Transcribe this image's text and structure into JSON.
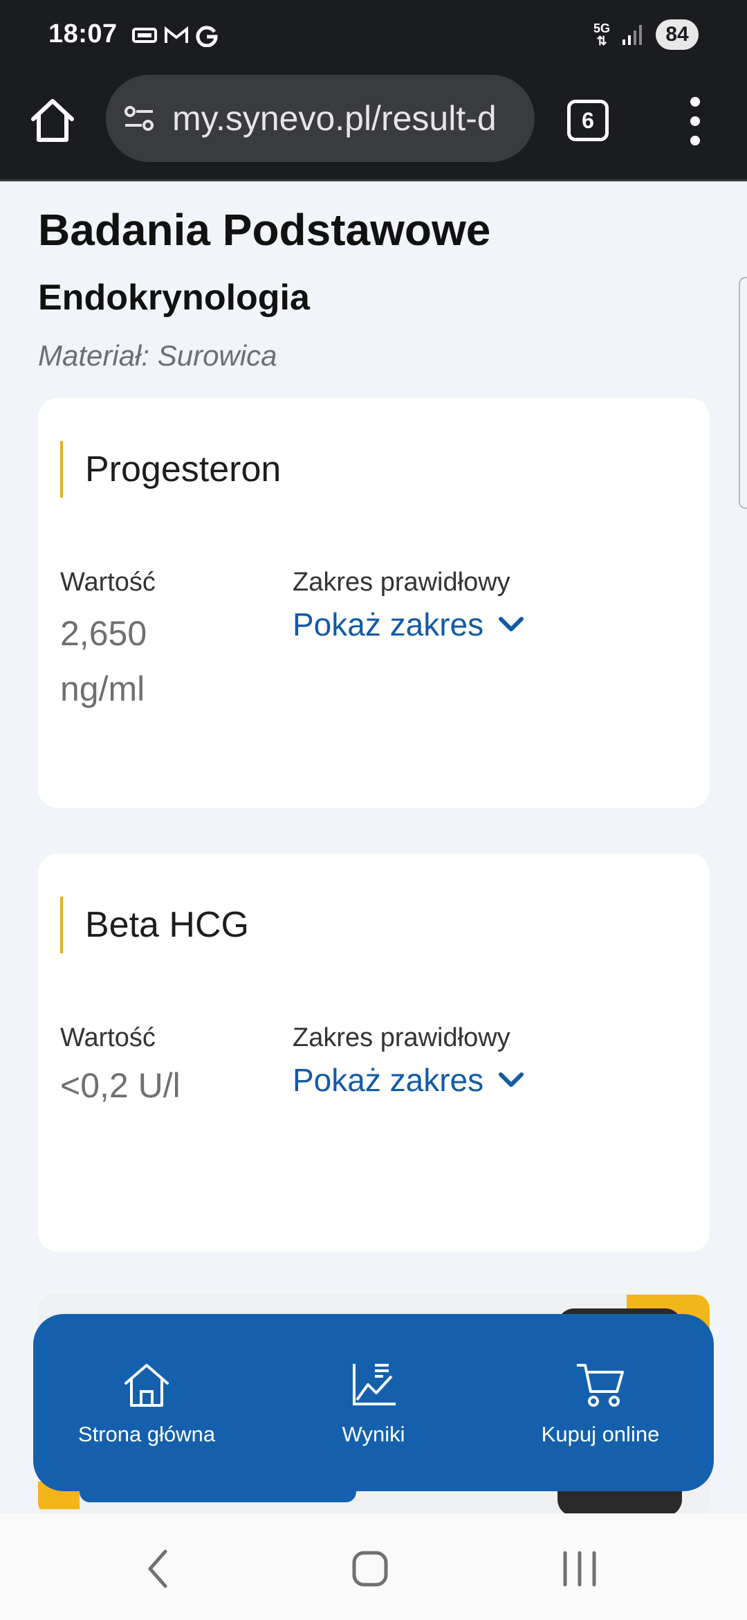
{
  "status_bar": {
    "time": "18:07",
    "network": "5G",
    "battery": "84",
    "icons": [
      "subscription-icon",
      "gmail-icon",
      "google-icon",
      "signal-icon"
    ]
  },
  "browser": {
    "url": "my.synevo.pl/result-d",
    "tab_count": "6"
  },
  "page": {
    "title": "Badania Podstawowe",
    "section": "Endokrynologia",
    "material": "Materiał: Surowica"
  },
  "results": [
    {
      "name": "Progesteron",
      "value_label": "Wartość",
      "value": "2,650 ng/ml",
      "range_label": "Zakres prawidłowy",
      "range_link": "Pokaż zakres"
    },
    {
      "name": "Beta HCG",
      "value_label": "Wartość",
      "value": "<0,2 U/l",
      "range_label": "Zakres prawidłowy",
      "range_link": "Pokaż zakres"
    }
  ],
  "bottom_nav": {
    "items": [
      {
        "label": "Strona główna",
        "icon": "home-icon"
      },
      {
        "label": "Wyniki",
        "icon": "chart-icon"
      },
      {
        "label": "Kupuj online",
        "icon": "cart-icon"
      }
    ]
  },
  "colors": {
    "primary": "#1560ad",
    "accent": "#e3b21d",
    "link": "#135aa6",
    "background": "#f1f4f8"
  }
}
